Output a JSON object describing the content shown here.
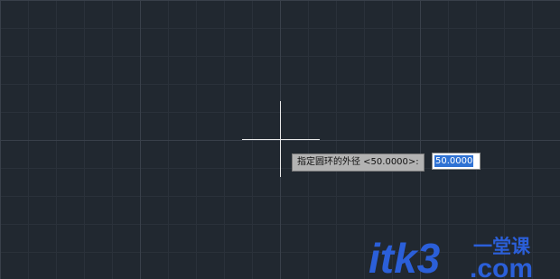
{
  "prompt": {
    "text": "指定圆环的外径 <50.0000>:"
  },
  "input": {
    "value": "50.0000"
  },
  "watermark": {
    "text_main": "itk3",
    "text_top": "一堂课",
    "text_bottom": ".com",
    "color": "#2b5fd9"
  },
  "colors": {
    "background": "#212830",
    "grid_major": "#39404a",
    "grid_minor": "#2a313a",
    "crosshair": "#e8e8e8",
    "selection": "#2f72d4"
  }
}
